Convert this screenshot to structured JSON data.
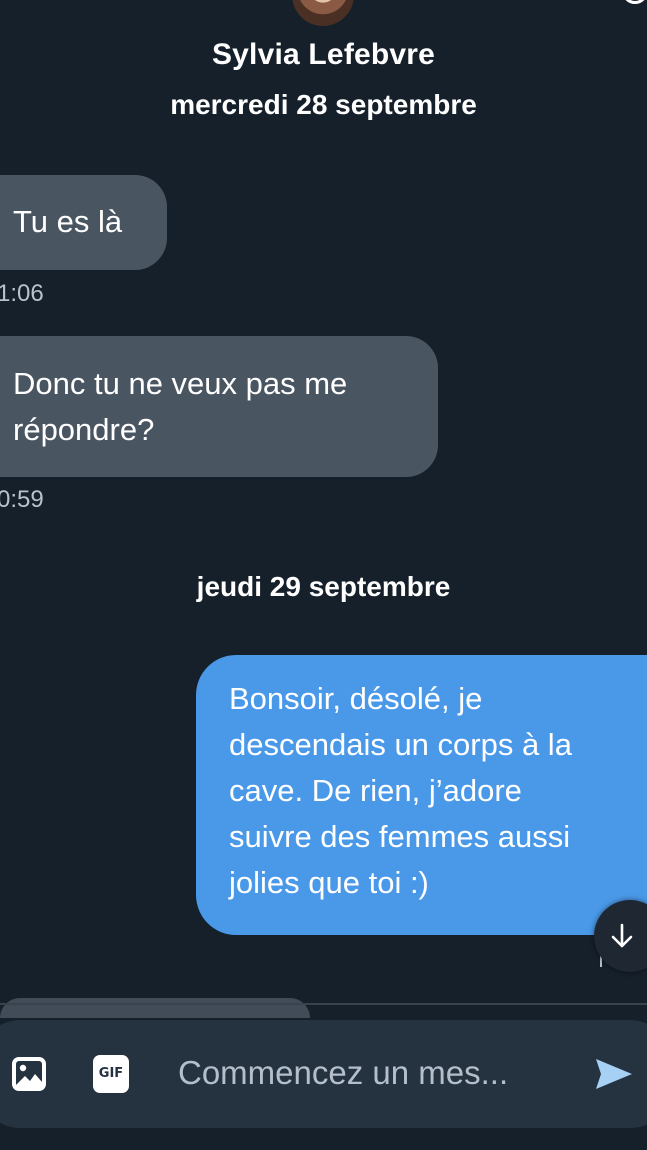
{
  "header": {
    "contact_name": "Sylvia Lefebvre"
  },
  "conversation": {
    "date_separators": [
      "mercredi 28 septembre",
      "jeudi 29 septembre"
    ],
    "messages": [
      {
        "direction": "incoming",
        "text": "Tu es là",
        "time": "1:06"
      },
      {
        "direction": "incoming",
        "text_lines": [
          "Donc tu ne veux pas me",
          "répondre?"
        ],
        "time": "0:59"
      },
      {
        "direction": "outgoing",
        "text_lines": [
          "Bonsoir, désolé, je",
          "descendais un corps à la",
          "cave. De rien, j’adore",
          "suivre des femmes aussi",
          "jolies que toi :)"
        ]
      }
    ]
  },
  "composer": {
    "placeholder": "Commencez un mes...",
    "gif_label": "GIF"
  },
  "colors": {
    "background": "#15202b",
    "incoming_bubble": "#4a5562",
    "outgoing_bubble": "#4a99e9",
    "composer": "#253341",
    "send_icon": "#a7d0f5"
  },
  "icons": {
    "avatar": "avatar",
    "info": "info-icon",
    "scroll_down": "arrow-down-icon",
    "image": "image-icon",
    "gif": "gif-icon",
    "send": "send-icon"
  }
}
